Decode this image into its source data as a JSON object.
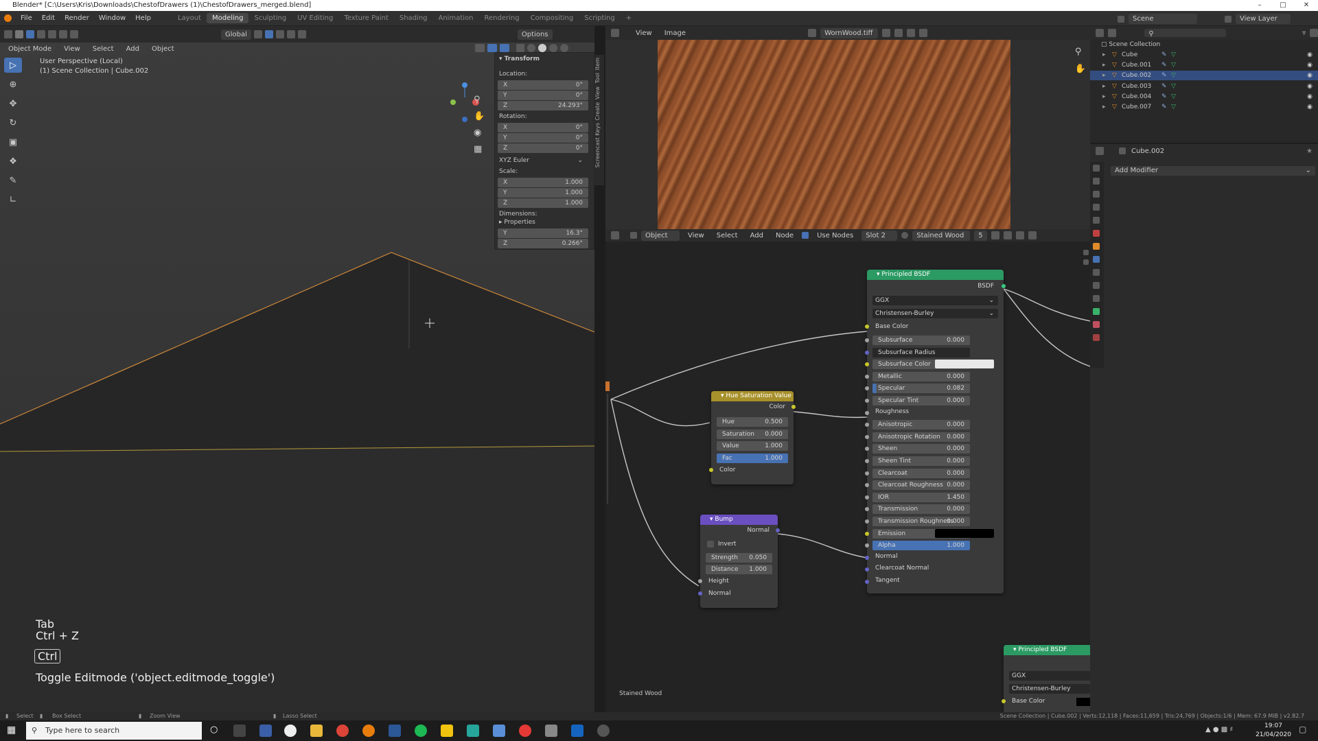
{
  "titlebar": {
    "title": "Blender* [C:\\Users\\Kris\\Downloads\\ChestofDrawers (1)\\ChestofDrawers_merged.blend]"
  },
  "menu": [
    "File",
    "Edit",
    "Render",
    "Window",
    "Help"
  ],
  "workspaces": [
    "Layout",
    "Modeling",
    "Sculpting",
    "UV Editing",
    "Texture Paint",
    "Shading",
    "Animation",
    "Rendering",
    "Compositing",
    "Scripting"
  ],
  "active_workspace": "Modeling",
  "scene": {
    "label": "Scene",
    "view_layer": "View Layer"
  },
  "viewport": {
    "mode": "Object Mode",
    "menus": [
      "View",
      "Select",
      "Add",
      "Object"
    ],
    "orientation": "Global",
    "options": "Options",
    "info_line1": "User Perspective (Local)",
    "info_line2": "(1) Scene Collection | Cube.002"
  },
  "npanel": {
    "section": "Transform",
    "location_label": "Location:",
    "location": [
      {
        "axis": "X",
        "value": "0°"
      },
      {
        "axis": "Y",
        "value": "0°"
      },
      {
        "axis": "Z",
        "value": "24.293°"
      }
    ],
    "rotation_label": "Rotation:",
    "rotation": [
      {
        "axis": "X",
        "value": "0°"
      },
      {
        "axis": "Y",
        "value": "0°"
      },
      {
        "axis": "Z",
        "value": "0°"
      }
    ],
    "euler": "XYZ Euler",
    "scale_label": "Scale:",
    "scale": [
      {
        "axis": "X",
        "value": "1.000"
      },
      {
        "axis": "Y",
        "value": "1.000"
      },
      {
        "axis": "Z",
        "value": "1.000"
      }
    ],
    "dimensions_label": "Dimensions:",
    "properties_label": "Properties",
    "dims": [
      {
        "axis": "Y",
        "value": "16.3°"
      },
      {
        "axis": "Z",
        "value": "0.266°"
      }
    ],
    "tabs": [
      "Item",
      "Tool",
      "View",
      "Create",
      "Screencast Keys"
    ]
  },
  "overlay": {
    "key1": "Tab",
    "key2": "Ctrl + Z",
    "key3": "Ctrl",
    "operator": "Toggle Editmode ('object.editmode_toggle')"
  },
  "image_editor": {
    "menus": [
      "View",
      "Image"
    ],
    "image_name": "WornWood.tiff"
  },
  "node_editor": {
    "object": "Object",
    "menus": [
      "View",
      "Select",
      "Add",
      "Node"
    ],
    "use_nodes": "Use Nodes",
    "slot": "Slot 2",
    "material": "Stained Wood",
    "users": "5",
    "footer_label": "Stained Wood",
    "hsv": {
      "title": "Hue Saturation Value",
      "out": "Color",
      "hue_l": "Hue",
      "hue": "0.500",
      "sat_l": "Saturation",
      "sat": "0.000",
      "val_l": "Value",
      "val": "1.000",
      "fac_l": "Fac",
      "fac": "1.000",
      "in": "Color"
    },
    "bump": {
      "title": "Bump",
      "out": "Normal",
      "invert": "Invert",
      "str_l": "Strength",
      "str": "0.050",
      "dist_l": "Distance",
      "dist": "1.000",
      "height": "Height",
      "normal": "Normal"
    },
    "bsdf": {
      "title": "Principled BSDF",
      "out": "BSDF",
      "dist": "GGX",
      "sss": "Christensen-Burley",
      "base_color": "Base Color",
      "rows": [
        {
          "l": "Subsurface",
          "v": "0.000"
        },
        {
          "l": "Subsurface Radius",
          "v": ""
        },
        {
          "l": "Subsurface Color",
          "v": ""
        },
        {
          "l": "Metallic",
          "v": "0.000"
        },
        {
          "l": "Specular",
          "v": "0.082"
        },
        {
          "l": "Specular Tint",
          "v": "0.000"
        },
        {
          "l": "Roughness",
          "v": ""
        },
        {
          "l": "Anisotropic",
          "v": "0.000"
        },
        {
          "l": "Anisotropic Rotation",
          "v": "0.000"
        },
        {
          "l": "Sheen",
          "v": "0.000"
        },
        {
          "l": "Sheen Tint",
          "v": "0.000"
        },
        {
          "l": "Clearcoat",
          "v": "0.000"
        },
        {
          "l": "Clearcoat Roughness",
          "v": "0.000"
        },
        {
          "l": "IOR",
          "v": "1.450"
        },
        {
          "l": "Transmission",
          "v": "0.000"
        },
        {
          "l": "Transmission Roughness",
          "v": "0.000"
        },
        {
          "l": "Emission",
          "v": ""
        },
        {
          "l": "Alpha",
          "v": "1.000"
        },
        {
          "l": "Normal",
          "v": ""
        },
        {
          "l": "Clearcoat Normal",
          "v": ""
        },
        {
          "l": "Tangent",
          "v": ""
        }
      ]
    },
    "bsdf2": {
      "title": "Principled BSDF",
      "dist": "GGX",
      "sss": "Christensen-Burley",
      "base_color": "Base Color"
    }
  },
  "outliner": {
    "root": "Scene Collection",
    "items": [
      "Cube",
      "Cube.001",
      "Cube.002",
      "Cube.003",
      "Cube.004",
      "Cube.007"
    ],
    "selected": "Cube.002"
  },
  "properties": {
    "object": "Cube.002",
    "add_modifier": "Add Modifier"
  },
  "statusbar": {
    "select": "Select",
    "box_select": "Box Select",
    "zoom_view": "Zoom View",
    "lasso_select": "Lasso Select",
    "stats": "Scene Collection | Cube.002 | Verts:12,118 | Faces:11,659 | Tris:24,769 | Objects:1/6 | Mem: 67.9 MiB | v2.82.7"
  },
  "taskbar": {
    "search_placeholder": "Type here to search",
    "time": "19:07",
    "date": "21/04/2020"
  },
  "colors": {
    "accent": "#4772b3",
    "node_shader_header": "#2b9a63",
    "node_color_header": "#a8902a",
    "node_vector_header": "#6a4fc0"
  }
}
